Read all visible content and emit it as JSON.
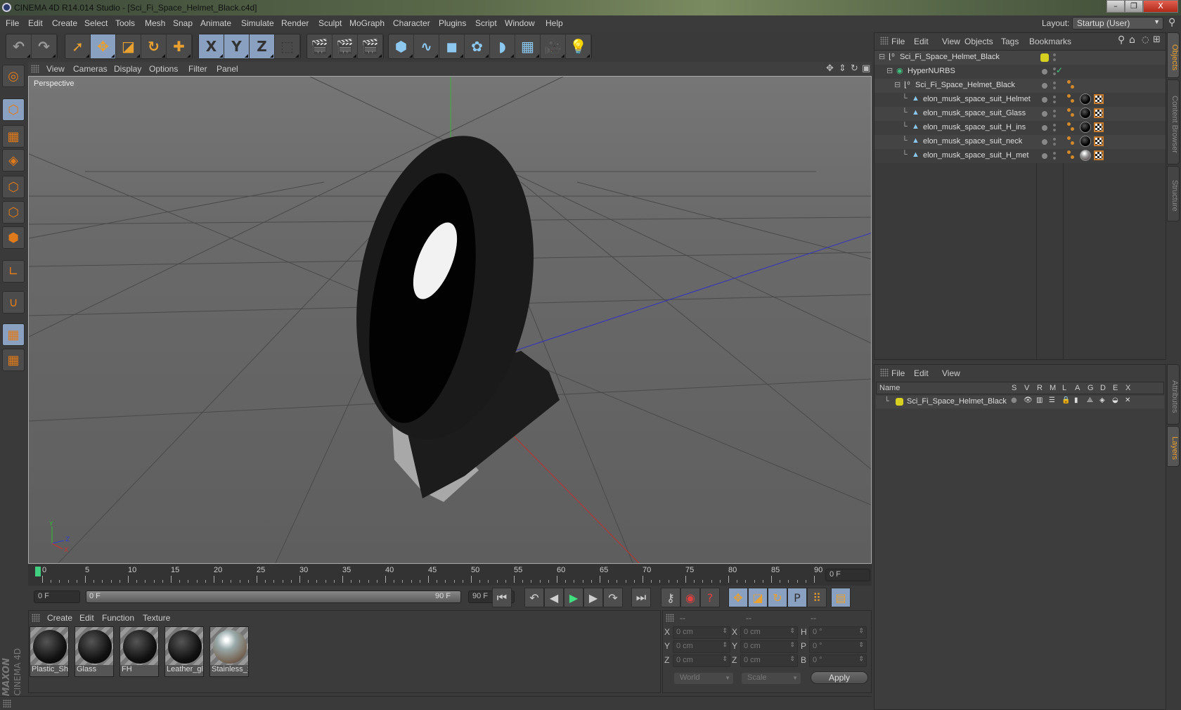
{
  "window": {
    "title": "CINEMA 4D R14.014 Studio - [Sci_Fi_Space_Helmet_Black.c4d]",
    "controls": {
      "minimize": "–",
      "restore": "❐",
      "close": "X"
    }
  },
  "menubar": {
    "items": [
      "File",
      "Edit",
      "Create",
      "Select",
      "Tools",
      "Mesh",
      "Snap",
      "Animate",
      "Simulate",
      "Render",
      "Sculpt",
      "MoGraph",
      "Character",
      "Plugins",
      "Script",
      "Window",
      "Help"
    ],
    "layout_label": "Layout:",
    "layout_value": "Startup (User)"
  },
  "toolbar": {
    "groups": [
      {
        "name": "history",
        "tools": [
          {
            "id": "undo",
            "icon": "undo-icon",
            "glyph": "↶"
          },
          {
            "id": "redo",
            "icon": "redo-icon",
            "glyph": "↷"
          }
        ]
      },
      {
        "name": "transform",
        "tools": [
          {
            "id": "select",
            "icon": "cursor-icon",
            "glyph": "➚"
          },
          {
            "id": "move",
            "icon": "move-icon",
            "glyph": "✥"
          },
          {
            "id": "scale",
            "icon": "scale-icon",
            "glyph": "◪"
          },
          {
            "id": "rotate",
            "icon": "rotate-icon",
            "glyph": "↻"
          },
          {
            "id": "add",
            "icon": "plus-icon",
            "glyph": "✚"
          }
        ]
      },
      {
        "name": "axis",
        "tools": [
          {
            "id": "x",
            "icon": "x-axis-icon",
            "glyph": "X"
          },
          {
            "id": "y",
            "icon": "y-axis-icon",
            "glyph": "Y"
          },
          {
            "id": "z",
            "icon": "z-axis-icon",
            "glyph": "Z"
          },
          {
            "id": "coord",
            "icon": "coordinate-system-icon",
            "glyph": "⬚"
          }
        ]
      },
      {
        "name": "render",
        "tools": [
          {
            "id": "render-view",
            "icon": "render-view-icon",
            "glyph": "🎬"
          },
          {
            "id": "render-picture",
            "icon": "render-picture-icon",
            "glyph": "🎬"
          },
          {
            "id": "render-settings",
            "icon": "render-settings-icon",
            "glyph": "🎬"
          }
        ]
      },
      {
        "name": "objects",
        "tools": [
          {
            "id": "cube",
            "icon": "cube-icon",
            "glyph": "⬢"
          },
          {
            "id": "spline",
            "icon": "spline-icon",
            "glyph": "∿"
          },
          {
            "id": "nurbs",
            "icon": "nurbs-icon",
            "glyph": "◼"
          },
          {
            "id": "array",
            "icon": "array-icon",
            "glyph": "✿"
          },
          {
            "id": "deformer",
            "icon": "deformer-icon",
            "glyph": "◗"
          },
          {
            "id": "floor",
            "icon": "floor-icon",
            "glyph": "▦"
          },
          {
            "id": "camera",
            "icon": "camera-icon",
            "glyph": "🎥"
          },
          {
            "id": "light",
            "icon": "light-icon",
            "glyph": "💡"
          }
        ]
      }
    ]
  },
  "left_tools": [
    {
      "id": "make-editable",
      "icon": "make-editable-icon",
      "glyph": "◎"
    },
    {
      "id": "model",
      "icon": "model-mode-icon",
      "glyph": "⬡",
      "selected": true
    },
    {
      "id": "texture",
      "icon": "texture-mode-icon",
      "glyph": "▦"
    },
    {
      "id": "workplane",
      "icon": "workplane-icon",
      "glyph": "◈"
    },
    {
      "id": "points",
      "icon": "points-mode-icon",
      "glyph": "⬡"
    },
    {
      "id": "edges",
      "icon": "edges-mode-icon",
      "glyph": "⬡"
    },
    {
      "id": "polygons",
      "icon": "polygons-mode-icon",
      "glyph": "⬢"
    },
    {
      "id": "axis",
      "icon": "axis-icon",
      "glyph": "∟"
    },
    {
      "id": "snap",
      "icon": "magnet-icon",
      "glyph": "∪"
    },
    {
      "id": "lock-workplane",
      "icon": "lock-grid-icon",
      "glyph": "▦",
      "selected": true
    },
    {
      "id": "planar-workplane",
      "icon": "grid-rotate-icon",
      "glyph": "▦"
    }
  ],
  "viewport": {
    "menu": [
      "View",
      "Cameras",
      "Display",
      "Options",
      "Filter",
      "Panel"
    ],
    "label": "Perspective",
    "nav_icons": [
      "move-view-icon",
      "zoom-view-icon",
      "rotate-view-icon",
      "maximize-view-icon"
    ],
    "axis_labels": {
      "x": "X",
      "y": "Y",
      "z": "Z"
    }
  },
  "timeline": {
    "ticks": [
      "0",
      "5",
      "10",
      "15",
      "20",
      "25",
      "30",
      "35",
      "40",
      "45",
      "50",
      "55",
      "60",
      "65",
      "70",
      "75",
      "80",
      "85",
      "90"
    ],
    "current_frame": "0 F",
    "start_field": "0 F",
    "range_start": "0 F",
    "range_end": "90 F",
    "end_field": "90 F"
  },
  "transport": {
    "buttons": [
      {
        "id": "goto-start",
        "icon": "goto-start-icon",
        "glyph": "⏮"
      },
      {
        "id": "prev-key",
        "icon": "previous-key-icon",
        "glyph": "↶"
      },
      {
        "id": "prev-frame",
        "icon": "previous-frame-icon",
        "glyph": "◀"
      },
      {
        "id": "play",
        "icon": "play-icon",
        "glyph": "▶"
      },
      {
        "id": "next-frame",
        "icon": "next-frame-icon",
        "glyph": "▶"
      },
      {
        "id": "next-key",
        "icon": "next-key-icon",
        "glyph": "↷"
      },
      {
        "id": "goto-end",
        "icon": "goto-end-icon",
        "glyph": "⏭"
      },
      {
        "id": "record-keys",
        "icon": "key-icon",
        "glyph": "⚷"
      },
      {
        "id": "autokey",
        "icon": "autokey-icon",
        "glyph": "◉"
      },
      {
        "id": "keyframe-selection",
        "icon": "help-icon",
        "glyph": "?"
      },
      {
        "id": "key-position",
        "icon": "move-icon",
        "glyph": "✥"
      },
      {
        "id": "key-scale",
        "icon": "scale-icon",
        "glyph": "◪"
      },
      {
        "id": "key-rotation",
        "icon": "rotate-icon",
        "glyph": "↻"
      },
      {
        "id": "key-param",
        "icon": "param-icon",
        "glyph": "P"
      },
      {
        "id": "key-pla",
        "icon": "pla-icon",
        "glyph": "⠿"
      },
      {
        "id": "timeline-window",
        "icon": "film-icon",
        "glyph": "▤"
      }
    ]
  },
  "materials": {
    "menu": [
      "Create",
      "Edit",
      "Function",
      "Texture"
    ],
    "items": [
      {
        "name": "Plastic_Shir",
        "type": "dark"
      },
      {
        "name": "Glass",
        "type": "dark"
      },
      {
        "name": "FH",
        "type": "dark"
      },
      {
        "name": "Leather_gl",
        "type": "dark"
      },
      {
        "name": "Stainless_S",
        "type": "env"
      }
    ]
  },
  "coordinates": {
    "headers": [
      "--",
      "--",
      "--"
    ],
    "rows": [
      {
        "l1": "X",
        "v1": "0 cm",
        "l2": "X",
        "v2": "0 cm",
        "l3": "H",
        "v3": "0 °"
      },
      {
        "l1": "Y",
        "v1": "0 cm",
        "l2": "Y",
        "v2": "0 cm",
        "l3": "P",
        "v3": "0 °"
      },
      {
        "l1": "Z",
        "v1": "0 cm",
        "l2": "Z",
        "v2": "0 cm",
        "l3": "B",
        "v3": "0 °"
      }
    ],
    "mode": "World",
    "transform": "Scale",
    "apply": "Apply"
  },
  "branding": {
    "line1": "MAXON",
    "line2": "CINEMA 4D"
  },
  "object_manager": {
    "menu": [
      "File",
      "Edit",
      "View",
      "Objects",
      "Tags",
      "Bookmarks"
    ],
    "toolbar_icons": [
      "search-icon",
      "home-icon",
      "eye-icon",
      "new-window-icon"
    ],
    "rows": [
      {
        "name": "Sci_Fi_Space_Helmet_Black",
        "icon": "null-object-icon",
        "depth": 0,
        "layer_color": "#d8d020",
        "tags": []
      },
      {
        "name": "HyperNURBS",
        "icon": "hypernurbs-icon",
        "depth": 1,
        "check": true,
        "tags": []
      },
      {
        "name": "Sci_Fi_Space_Helmet_Black",
        "icon": "null-object-icon",
        "depth": 2,
        "tags": [
          "phong"
        ]
      },
      {
        "name": "elon_musk_space_suit_Helmet",
        "icon": "polygon-object-icon",
        "depth": 3,
        "tags": [
          "phong",
          "material",
          "uvw"
        ]
      },
      {
        "name": "elon_musk_space_suit_Glass",
        "icon": "polygon-object-icon",
        "depth": 3,
        "tags": [
          "phong",
          "material",
          "uvw"
        ]
      },
      {
        "name": "elon_musk_space_suit_H_ins",
        "icon": "polygon-object-icon",
        "depth": 3,
        "tags": [
          "phong",
          "material",
          "uvw"
        ]
      },
      {
        "name": "elon_musk_space_suit_neck",
        "icon": "polygon-object-icon",
        "depth": 3,
        "tags": [
          "phong",
          "material",
          "uvw"
        ]
      },
      {
        "name": "elon_musk_space_suit_H_met",
        "icon": "polygon-object-icon",
        "depth": 3,
        "tags": [
          "phong",
          "material-env",
          "uvw"
        ]
      }
    ]
  },
  "layer_manager": {
    "menu": [
      "File",
      "Edit",
      "View"
    ],
    "columns": [
      "Name",
      "S",
      "V",
      "R",
      "M",
      "L",
      "A",
      "G",
      "D",
      "E",
      "X"
    ],
    "rows": [
      {
        "name": "Sci_Fi_Space_Helmet_Black",
        "color": "#d8d020"
      }
    ]
  },
  "side_tabs": {
    "top": [
      {
        "label": "Objects",
        "active": true
      },
      {
        "label": "Content Browser",
        "active": false
      },
      {
        "label": "Structure",
        "active": false
      }
    ],
    "bottom": [
      {
        "label": "Attributes",
        "active": false
      },
      {
        "label": "Layers",
        "active": true
      }
    ]
  },
  "colors": {
    "accent": "#e8a030",
    "selection": "#8aa0c0",
    "x_axis": "#c03030",
    "y_axis": "#30c030",
    "z_axis": "#3030c0"
  }
}
